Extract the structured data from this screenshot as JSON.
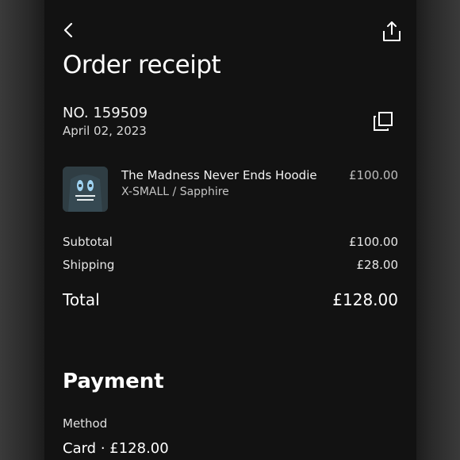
{
  "header": {
    "title": "Order receipt",
    "back_icon": "chevron-left-icon",
    "share_icon": "share-icon"
  },
  "order": {
    "number": "NO. 159509",
    "date": "April 02, 2023",
    "copy_icon": "copy-icon"
  },
  "item": {
    "name": "The Madness Never Ends Hoodie",
    "variant": "X-SMALL / Sapphire",
    "price": "£100.00",
    "thumbnail_text": "the madness never ends"
  },
  "summary": {
    "subtotal_label": "Subtotal",
    "subtotal_value": "£100.00",
    "shipping_label": "Shipping",
    "shipping_value": "£28.00",
    "total_label": "Total",
    "total_value": "£128.00"
  },
  "payment": {
    "title": "Payment",
    "method_label": "Method",
    "method_value": "Card · £128.00"
  },
  "colors": {
    "background": "#121212",
    "text": "#ffffff",
    "muted": "#bdbdbd",
    "thumbnail": "#2f3d43"
  }
}
